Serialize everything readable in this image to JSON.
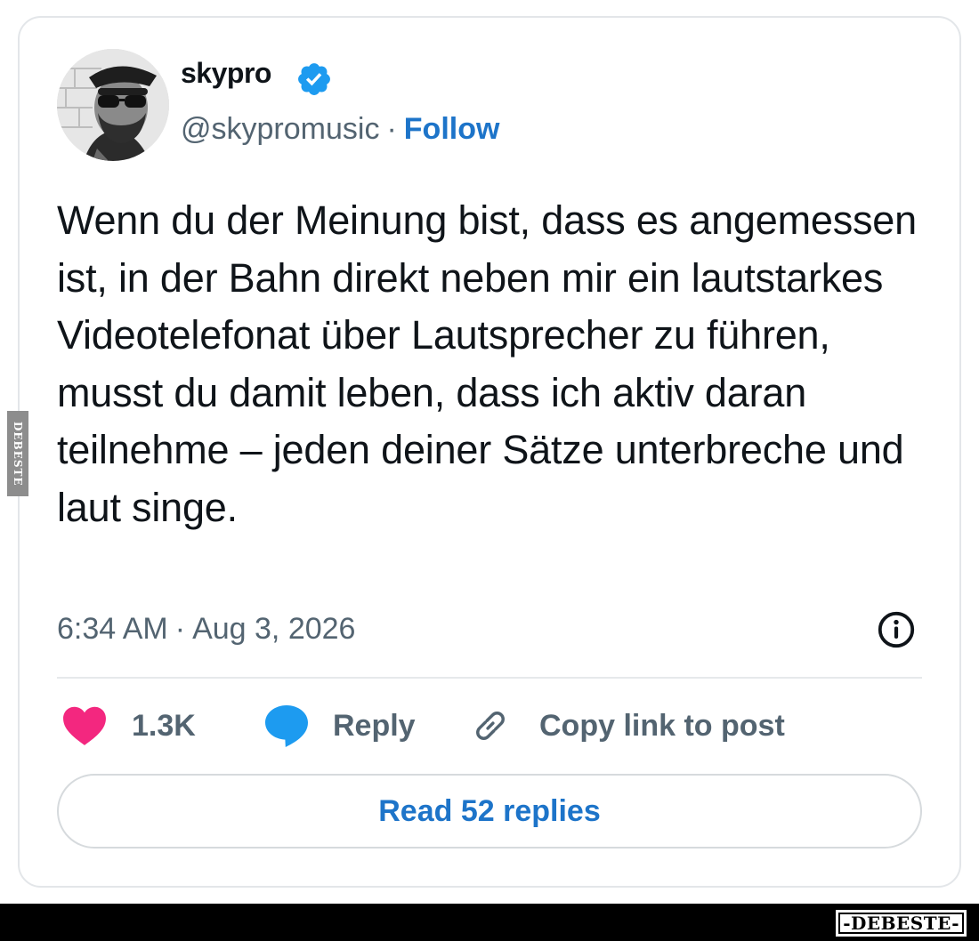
{
  "author": {
    "display_name": "skypro",
    "handle": "@skypromusic",
    "separator": "·",
    "follow_label": "Follow",
    "verified": true,
    "avatar_icon": "avatar-photo"
  },
  "post": {
    "text": "Wenn du der Meinung bist, dass es angemessen ist, in der Bahn direkt neben mir ein lautstarkes Videotelefonat über Lautsprecher zu führen, musst du damit leben, dass ich aktiv daran teilnehme – jeden deiner Sätze unterbreche und laut singe.",
    "time": "6:34 AM",
    "separator": "·",
    "date": "Aug 3, 2026"
  },
  "actions": {
    "likes_count": "1.3K",
    "reply_label": "Reply",
    "copy_link_label": "Copy link to post",
    "read_replies_label": "Read 52 replies"
  },
  "watermark": {
    "side_text": "DEBESTE",
    "footer_text": "-DEBESTE-"
  },
  "colors": {
    "accent": "#1d74c9",
    "heart": "#f3277f",
    "verified": "#1d9bf0",
    "muted": "#536471"
  }
}
